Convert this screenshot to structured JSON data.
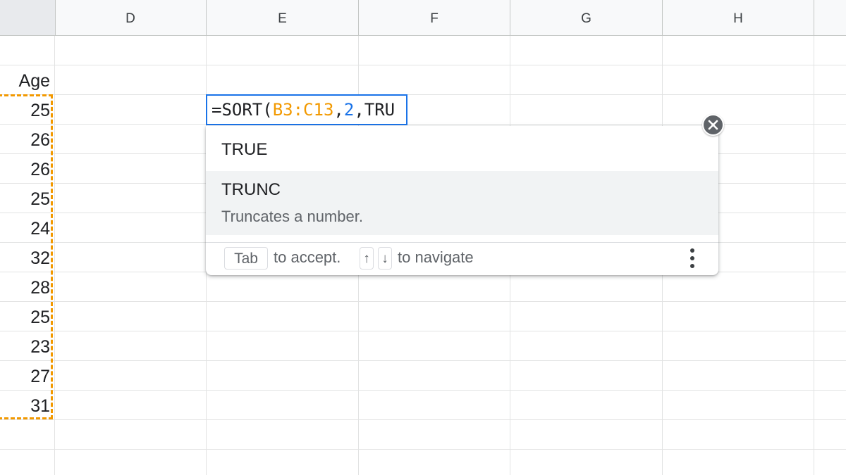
{
  "columns": [
    {
      "label": "D"
    },
    {
      "label": "E"
    },
    {
      "label": "F"
    },
    {
      "label": "G"
    },
    {
      "label": "H"
    }
  ],
  "column_c": {
    "header": "Age",
    "values": [
      "25",
      "26",
      "26",
      "25",
      "24",
      "32",
      "28",
      "25",
      "23",
      "27",
      "31"
    ]
  },
  "editor": {
    "prefix": "=SORT(",
    "range": "B3:C13",
    "sep1": ",",
    "number": "2",
    "sep2": ",",
    "typed": "TRU"
  },
  "autocomplete": {
    "suggestions": [
      {
        "name": "TRUE",
        "description": ""
      },
      {
        "name": "TRUNC",
        "description": "Truncates a number."
      }
    ],
    "footer": {
      "tab_key": "Tab",
      "accept_text": "to accept.",
      "up_key": "↑",
      "down_key": "↓",
      "navigate_text": "to navigate"
    },
    "more_icon": "more-vert-icon",
    "close_icon": "close-icon"
  },
  "colors": {
    "range_highlight": "#f29900",
    "active_border": "#1a73e8",
    "number_token": "#1a73e8"
  }
}
